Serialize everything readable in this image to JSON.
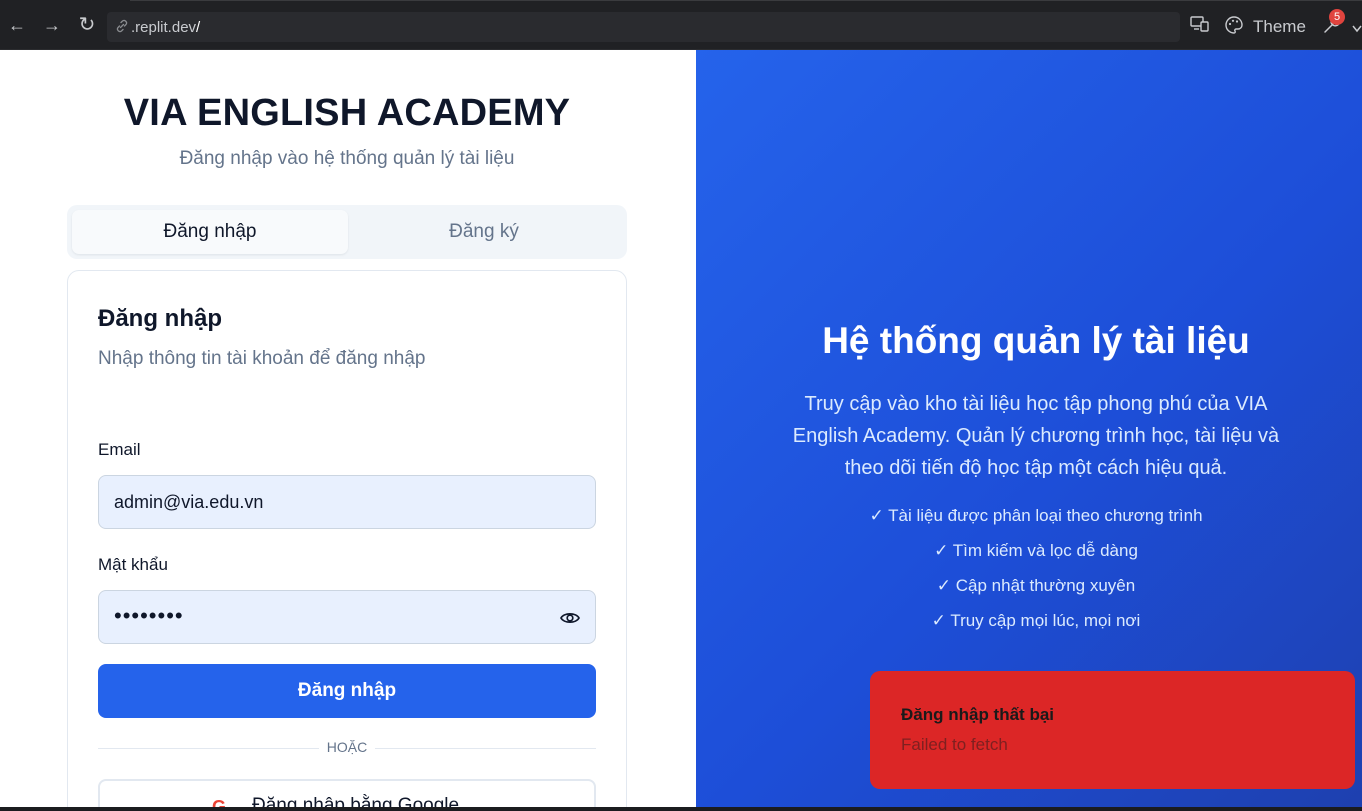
{
  "browser": {
    "url_prefix": ".replit.dev",
    "url_suffix": "/",
    "theme_label": "Theme",
    "notification_count": "5",
    "back_glyph": "←",
    "forward_glyph": "→",
    "reload_glyph": "↻",
    "link_glyph": "⛓",
    "devices_glyph": "🖵",
    "palette_glyph": "🎨",
    "tools_glyph": "🔧"
  },
  "login": {
    "brand": "VIA ENGLISH ACADEMY",
    "subtitle": "Đăng nhập vào hệ thống quản lý tài liệu",
    "tabs": [
      {
        "label": "Đăng nhập",
        "active": true
      },
      {
        "label": "Đăng ký",
        "active": false
      }
    ],
    "card_title": "Đăng nhập",
    "card_desc": "Nhập thông tin tài khoản để đăng nhập",
    "email_label": "Email",
    "email_value": "admin@via.edu.vn",
    "password_label": "Mật khẩu",
    "password_masked": "••••••••",
    "submit_label": "Đăng nhập",
    "or_label": "HOẶC",
    "google_glyph": "G",
    "google_label": "Đăng nhập bằng Google"
  },
  "hero": {
    "title": "Hệ thống quản lý tài liệu",
    "description": "Truy cập vào kho tài liệu học tập phong phú của VIA English Academy. Quản lý chương trình học, tài liệu và theo dõi tiến độ học tập một cách hiệu quả.",
    "features": [
      "✓ Tài liệu được phân loại theo chương trình",
      "✓ Tìm kiếm và lọc dễ dàng",
      "✓ Cập nhật thường xuyên",
      "✓ Truy cập mọi lúc, mọi nơi"
    ]
  },
  "toast": {
    "title": "Đăng nhập thất bại",
    "message": "Failed to fetch"
  },
  "colors": {
    "primary": "#2563eb",
    "error": "#dc2626",
    "input_bg": "#e8f0fe"
  }
}
